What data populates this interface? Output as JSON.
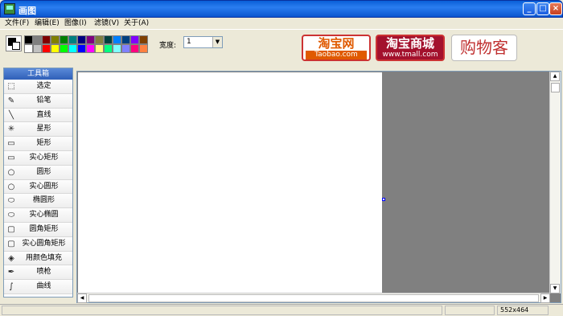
{
  "window": {
    "title": "画图",
    "min": "_",
    "max": "□",
    "close": "×"
  },
  "menu": [
    "文件(F)",
    "编辑(E)",
    "图像(I)",
    "滤镜(V)",
    "关于(A)"
  ],
  "palette": [
    "#000000",
    "#808080",
    "#800000",
    "#808000",
    "#008000",
    "#008080",
    "#000080",
    "#800080",
    "#808040",
    "#004040",
    "#0080ff",
    "#004080",
    "#8000ff",
    "#804000",
    "#ffffff",
    "#c0c0c0",
    "#ff0000",
    "#ffff00",
    "#00ff00",
    "#00ffff",
    "#0000ff",
    "#ff00ff",
    "#ffff80",
    "#00ff80",
    "#80ffff",
    "#8080ff",
    "#ff0080",
    "#ff8040"
  ],
  "width": {
    "label": "宽度:",
    "value": "1"
  },
  "banners": {
    "taobao": {
      "main": "淘宝网",
      "sub": "Taobao.com"
    },
    "tmall": {
      "main": "淘宝商城",
      "sub": "www.tmall.com"
    },
    "gouwu": {
      "main": "购物客"
    }
  },
  "toolbox": {
    "title": "工具箱",
    "tools": [
      {
        "label": "选定",
        "icon": "⬚"
      },
      {
        "label": "铅笔",
        "icon": "✎"
      },
      {
        "label": "直线",
        "icon": "╲"
      },
      {
        "label": "星形",
        "icon": "✳"
      },
      {
        "label": "矩形",
        "icon": "▭"
      },
      {
        "label": "实心矩形",
        "icon": "▭"
      },
      {
        "label": "圆形",
        "icon": "○"
      },
      {
        "label": "实心圆形",
        "icon": "○"
      },
      {
        "label": "椭圆形",
        "icon": "⬭"
      },
      {
        "label": "实心椭圆",
        "icon": "⬭"
      },
      {
        "label": "圆角矩形",
        "icon": "▢"
      },
      {
        "label": "实心圆角矩形",
        "icon": "▢"
      },
      {
        "label": "用颜色填充",
        "icon": "◈"
      },
      {
        "label": "喷枪",
        "icon": "✒"
      },
      {
        "label": "曲线",
        "icon": "∫"
      }
    ]
  },
  "status": {
    "size": "552x464"
  }
}
